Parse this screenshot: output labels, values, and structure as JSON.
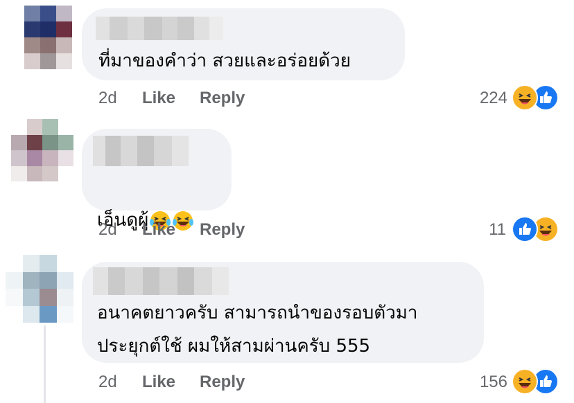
{
  "comments": [
    {
      "text": "ที่มาของคำว่า สวยและอร่อยด้วย",
      "time": "2d",
      "like_label": "Like",
      "reply_label": "Reply",
      "reaction_count": "224",
      "reactions": [
        "haha-icon",
        "like-icon"
      ]
    },
    {
      "text": "เอ็นดูผู้",
      "emoji": [
        "laughing-tears-emoji",
        "laughing-tears-emoji"
      ],
      "time": "2d",
      "like_label": "Like",
      "reply_label": "Reply",
      "reaction_count": "11",
      "reactions": [
        "like-icon",
        "haha-icon"
      ]
    },
    {
      "text": "อนาคตยาวครับ สามารถนำของรอบตัวมา\nประยุกต์ใช้ ผมให้สามผ่านครับ 555",
      "time": "2d",
      "like_label": "Like",
      "reply_label": "Reply",
      "reaction_count": "156",
      "reactions": [
        "haha-icon",
        "like-icon"
      ]
    }
  ],
  "colors": {
    "bubble": "#f0f2f5",
    "meta_text": "#65676b",
    "like_blue": "#1877f2",
    "haha_yellow": "#f7b125"
  }
}
